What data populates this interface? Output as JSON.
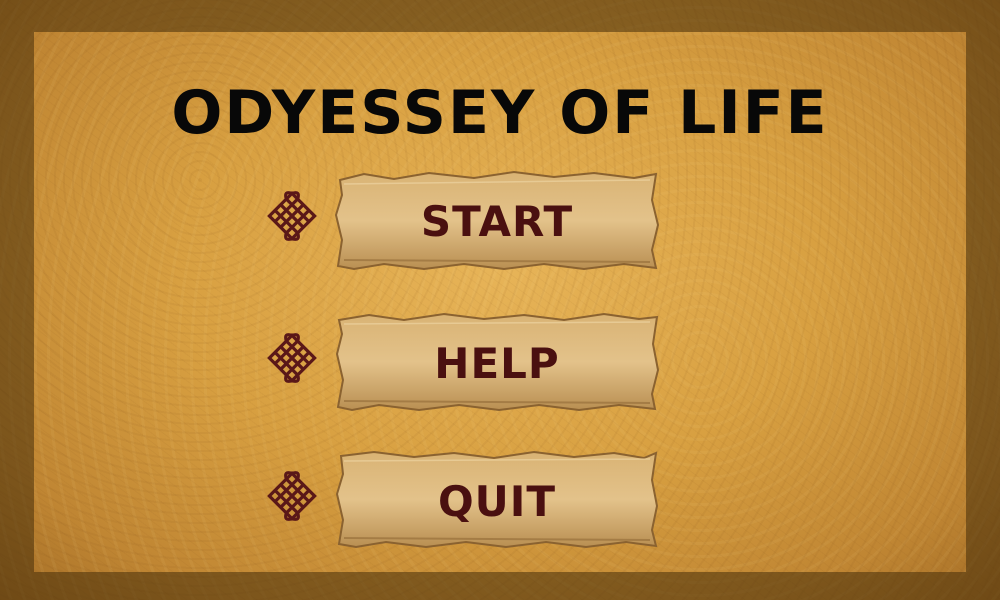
{
  "title": "ODYESSEY OF LIFE",
  "menu": {
    "items": [
      {
        "id": "start",
        "label": "START"
      },
      {
        "id": "help",
        "label": "HELP"
      },
      {
        "id": "quit",
        "label": "QUIT"
      }
    ],
    "ornament_icon": "endless-knot-icon"
  },
  "colors": {
    "title": "#080808",
    "button_text": "#4a1010",
    "ornament": "#5a1818",
    "plank": "#d7ae6c"
  }
}
